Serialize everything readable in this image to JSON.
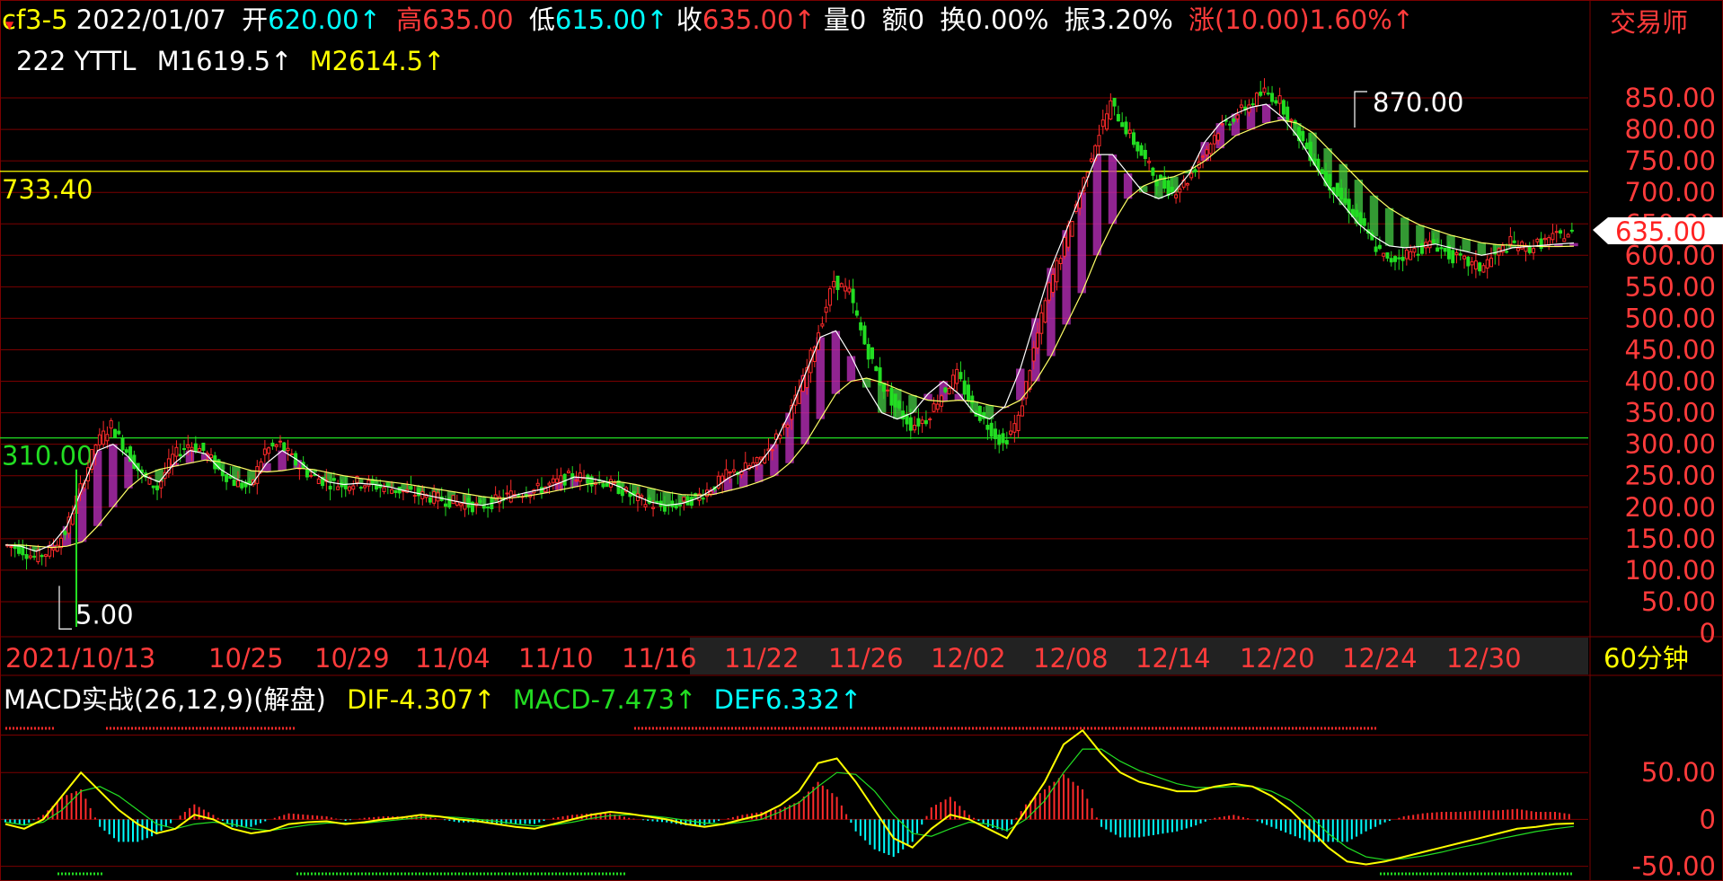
{
  "header": {
    "symbol": "cf3-5",
    "date": "2022/01/07",
    "open_label": "开",
    "open": "620.00↑",
    "high_label": "高",
    "high": "635.00",
    "low_label": "低",
    "low": "615.00↑",
    "close_label": "收",
    "close": "635.00↑",
    "volume_label": "量",
    "volume": "0",
    "amount_label": "额",
    "amount": "0",
    "turnover_label": "换",
    "turnover": "0.00%",
    "amplitude_label": "振",
    "amplitude": "3.20%",
    "change_label": "涨",
    "change": "(10.00)1.60%↑",
    "brand": "交易师"
  },
  "indicator": {
    "marker": "▼",
    "line1_prefix": "222 YTTL",
    "m1_label": "M1",
    "m1_value": "619.5↑",
    "m2_label": "M2",
    "m2_value": "614.5↑"
  },
  "price_panel": {
    "ref_line_high": "733.40",
    "ref_line_low": "310.00",
    "max_marker": "870.00",
    "min_marker": "5.00",
    "last_price": "635.00",
    "y_axis_ticks": [
      "850.00",
      "800.00",
      "750.00",
      "700.00",
      "650.00",
      "600.00",
      "550.00",
      "500.00",
      "450.00",
      "400.00",
      "350.00",
      "300.00",
      "250.00",
      "200.00",
      "150.00",
      "100.00",
      "50.00",
      "0"
    ]
  },
  "time_axis": {
    "labels": [
      "2021/10/13",
      "10/25",
      "10/29",
      "11/04",
      "11/10",
      "11/16",
      "11/22",
      "11/26",
      "12/02",
      "12/08",
      "12/14",
      "12/20",
      "12/24",
      "12/30"
    ],
    "period": "60分钟"
  },
  "macd_panel": {
    "title": "MACD实战(26,12,9)(解盘)",
    "dif_label": "DIF",
    "dif_value": "-4.307↑",
    "macd_label": "MACD",
    "macd_value": "-7.473↑",
    "def_label": "DEF",
    "def_value": "6.332↑",
    "y_axis_ticks": [
      "50.00",
      "0",
      "-50.00"
    ]
  },
  "colors": {
    "background": "#000000",
    "grid": "#7a0000",
    "axis_text": "#ff3b3b",
    "up": "#ff2a2a",
    "down": "#22dd22",
    "yellow": "#ffff00",
    "cyan": "#00ffff",
    "white": "#ffffff"
  },
  "chart_data": [
    {
      "type": "candlestick",
      "title": "cf3-5",
      "x_labels": [
        "2021/10/13",
        "10/25",
        "10/29",
        "11/04",
        "11/10",
        "11/16",
        "11/22",
        "11/26",
        "12/02",
        "12/08",
        "12/14",
        "12/20",
        "12/24",
        "12/30"
      ],
      "ylim": [
        0,
        870
      ],
      "ref_lines": [
        733.4,
        310.0
      ],
      "close_path": [
        140,
        135,
        120,
        130,
        160,
        230,
        300,
        330,
        290,
        250,
        230,
        280,
        300,
        290,
        260,
        240,
        230,
        290,
        300,
        270,
        250,
        240,
        235,
        240,
        235,
        230,
        225,
        220,
        215,
        210,
        205,
        200,
        210,
        220,
        225,
        230,
        240,
        250,
        245,
        240,
        230,
        215,
        205,
        200,
        205,
        215,
        230,
        250,
        260,
        270,
        300,
        340,
        400,
        480,
        560,
        540,
        460,
        400,
        360,
        330,
        340,
        380,
        410,
        360,
        330,
        300,
        340,
        450,
        550,
        620,
        700,
        780,
        840,
        800,
        760,
        720,
        700,
        720,
        760,
        800,
        820,
        840,
        860,
        845,
        800,
        760,
        720,
        690,
        660,
        620,
        590,
        600,
        610,
        620,
        600,
        590,
        580,
        600,
        620,
        610,
        620,
        630,
        635
      ],
      "ma1_path": [
        140,
        138,
        130,
        140,
        170,
        230,
        290,
        300,
        280,
        250,
        240,
        270,
        290,
        285,
        260,
        245,
        235,
        270,
        290,
        275,
        255,
        240,
        236,
        238,
        236,
        232,
        226,
        221,
        216,
        211,
        206,
        203,
        208,
        218,
        224,
        229,
        238,
        248,
        246,
        241,
        232,
        218,
        208,
        203,
        206,
        214,
        228,
        246,
        258,
        268,
        300,
        350,
        410,
        470,
        480,
        440,
        390,
        350,
        340,
        350,
        380,
        400,
        380,
        350,
        340,
        360,
        420,
        500,
        580,
        640,
        700,
        760,
        760,
        730,
        700,
        690,
        700,
        730,
        780,
        810,
        825,
        835,
        840,
        820,
        790,
        750,
        710,
        680,
        650,
        630,
        615,
        612,
        614,
        618,
        612,
        606,
        600,
        605,
        612,
        614,
        616,
        618,
        619.5
      ],
      "ma2_path": [
        140,
        140,
        138,
        136,
        138,
        145,
        170,
        200,
        230,
        250,
        260,
        265,
        270,
        275,
        272,
        265,
        258,
        256,
        258,
        262,
        260,
        255,
        250,
        246,
        243,
        240,
        237,
        233,
        229,
        225,
        221,
        217,
        214,
        215,
        218,
        222,
        227,
        232,
        237,
        240,
        240,
        236,
        230,
        224,
        220,
        219,
        220,
        226,
        232,
        240,
        250,
        270,
        300,
        340,
        380,
        400,
        405,
        398,
        388,
        378,
        370,
        368,
        370,
        368,
        362,
        358,
        370,
        400,
        440,
        490,
        540,
        600,
        650,
        690,
        710,
        720,
        725,
        735,
        750,
        770,
        790,
        800,
        810,
        815,
        810,
        795,
        770,
        745,
        720,
        695,
        675,
        660,
        648,
        640,
        632,
        626,
        620,
        617,
        616,
        615,
        614,
        614,
        614.5
      ]
    },
    {
      "type": "line",
      "title": "MACD实战(26,12,9)(解盘)",
      "ylim": [
        -60,
        100
      ],
      "series": [
        {
          "name": "DIF",
          "values": [
            -5,
            -10,
            0,
            25,
            50,
            30,
            10,
            -5,
            -15,
            -10,
            5,
            0,
            -10,
            -15,
            -12,
            -5,
            -3,
            -2,
            -5,
            -3,
            0,
            2,
            5,
            3,
            0,
            -2,
            -5,
            -8,
            -10,
            -5,
            0,
            5,
            8,
            6,
            3,
            0,
            -5,
            -8,
            -5,
            0,
            5,
            15,
            30,
            60,
            65,
            40,
            10,
            -20,
            -30,
            -10,
            5,
            0,
            -10,
            -20,
            10,
            40,
            80,
            95,
            70,
            50,
            40,
            35,
            30,
            30,
            35,
            38,
            35,
            25,
            10,
            -10,
            -30,
            -45,
            -48,
            -45,
            -40,
            -35,
            -30,
            -25,
            -20,
            -15,
            -10,
            -8,
            -5,
            -4.307
          ]
        },
        {
          "name": "MACD",
          "values": [
            -3,
            -6,
            -3,
            10,
            30,
            35,
            25,
            10,
            -5,
            -10,
            -5,
            -3,
            -5,
            -10,
            -12,
            -9,
            -6,
            -4,
            -4,
            -4,
            -2,
            0,
            2,
            3,
            2,
            0,
            -2,
            -5,
            -7,
            -6,
            -3,
            1,
            4,
            5,
            4,
            2,
            -1,
            -4,
            -5,
            -3,
            0,
            8,
            18,
            35,
            50,
            48,
            30,
            5,
            -15,
            -18,
            -10,
            -3,
            -5,
            -12,
            0,
            20,
            50,
            75,
            75,
            62,
            52,
            45,
            38,
            34,
            34,
            35,
            35,
            30,
            20,
            5,
            -15,
            -30,
            -40,
            -43,
            -42,
            -39,
            -35,
            -30,
            -26,
            -21,
            -17,
            -13,
            -10,
            -7.473
          ]
        }
      ]
    }
  ]
}
